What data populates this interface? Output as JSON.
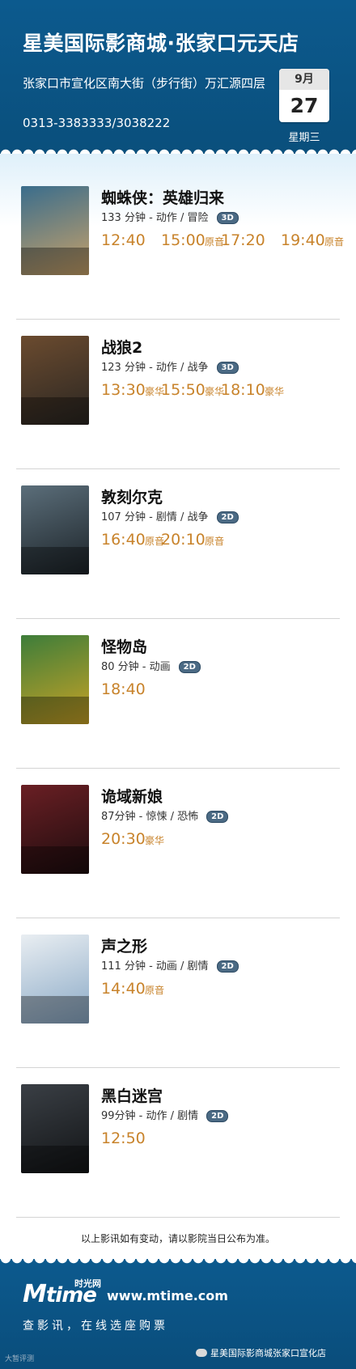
{
  "header": {
    "title": "星美国际影商城·张家口元天店",
    "address": "张家口市宣化区南大街（步行街）万汇源四层",
    "phone": "0313-3383333/3038222",
    "calendar": {
      "month": "9月",
      "day": "27",
      "weekday": "星期三"
    }
  },
  "colors": {
    "header_bg": "#0c5a8e",
    "time_orange": "#c8832b"
  },
  "movies": [
    {
      "name": "蜘蛛侠：英雄归来",
      "meta": "133 分钟 - 动作 / 冒险",
      "format": "3D",
      "poster_colors": [
        "#3a6d8c",
        "#c9a269"
      ],
      "showtimes": [
        {
          "time": "12:40",
          "tag": ""
        },
        {
          "time": "15:00",
          "tag": "原音"
        },
        {
          "time": "17:20",
          "tag": ""
        },
        {
          "time": "19:40",
          "tag": "原音"
        }
      ]
    },
    {
      "name": "战狼2",
      "meta": "123 分钟 - 动作 / 战争",
      "format": "3D",
      "poster_colors": [
        "#6b4b2f",
        "#2a2622"
      ],
      "showtimes": [
        {
          "time": "13:30",
          "tag": "豪华"
        },
        {
          "time": "15:50",
          "tag": "豪华"
        },
        {
          "time": "18:10",
          "tag": "豪华"
        }
      ]
    },
    {
      "name": "敦刻尔克",
      "meta": "107 分钟 - 剧情 / 战争",
      "format": "2D",
      "poster_colors": [
        "#5b6e7a",
        "#1c2328"
      ],
      "showtimes": [
        {
          "time": "16:40",
          "tag": "原音"
        },
        {
          "time": "20:10",
          "tag": "原音"
        }
      ]
    },
    {
      "name": "怪物岛",
      "meta": "80 分钟 - 动画",
      "format": "2D",
      "poster_colors": [
        "#3d7d3a",
        "#c9a326"
      ],
      "showtimes": [
        {
          "time": "18:40",
          "tag": ""
        }
      ]
    },
    {
      "name": "诡域新娘",
      "meta": "87分钟 - 惊悚 / 恐怖",
      "format": "2D",
      "poster_colors": [
        "#6a1f24",
        "#1d0c0e"
      ],
      "showtimes": [
        {
          "time": "20:30",
          "tag": "豪华"
        }
      ]
    },
    {
      "name": "声之形",
      "meta": "111 分钟 - 动画 / 剧情",
      "format": "2D",
      "poster_colors": [
        "#e9eef2",
        "#8aa9c6"
      ],
      "showtimes": [
        {
          "time": "14:40",
          "tag": "原音"
        }
      ]
    },
    {
      "name": "黑白迷宫",
      "meta": "99分钟 - 动作 / 剧情",
      "format": "2D",
      "poster_colors": [
        "#3a3f45",
        "#121416"
      ],
      "showtimes": [
        {
          "time": "12:50",
          "tag": ""
        }
      ]
    }
  ],
  "note": "以上影讯如有变动，请以影院当日公布为准。",
  "footer": {
    "logo_m": "M",
    "logo_rest": "time",
    "logo_cn": "时光网",
    "url": "www.mtime.com",
    "slogan": "查影讯，在线选座购票",
    "wechat_account": "星美国际影商城张家口宣化店",
    "credit": "大暂评测"
  }
}
